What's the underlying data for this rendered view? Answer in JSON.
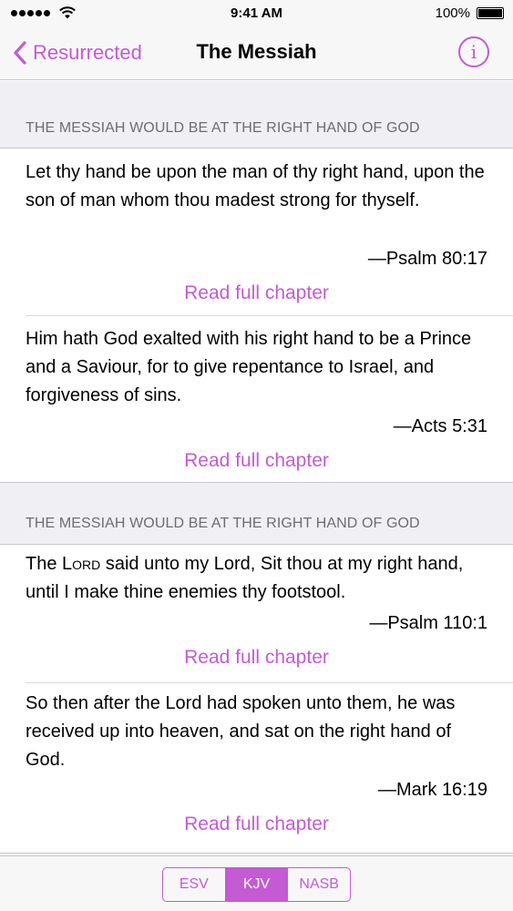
{
  "status_bar": {
    "time": "9:41 AM",
    "battery": "100%",
    "icons": [
      "signal-dots-icon",
      "wifi-icon",
      "battery-icon"
    ]
  },
  "nav": {
    "back_label": "Resurrected",
    "title": "The Messiah",
    "info_symbol": "i",
    "icons": [
      "chevron-left-icon",
      "info-icon"
    ]
  },
  "sections": [
    {
      "header": "THE MESSIAH WOULD BE AT THE RIGHT HAND OF GOD",
      "entries": [
        {
          "verse": "Let thy hand be upon the man of thy right hand, upon the son of man whom thou madest strong for thyself.",
          "reference": "—Psalm 80:17",
          "link": "Read full chapter"
        },
        {
          "verse": "Him hath God exalted with his right hand to be a Prince and a Saviour, for to give repentance to Israel, and forgiveness of sins.",
          "reference": "—Acts 5:31",
          "link": "Read full chapter"
        }
      ]
    },
    {
      "header": "THE MESSIAH WOULD BE AT THE RIGHT HAND OF GOD",
      "entries": [
        {
          "verse_parts": [
            "The ",
            "Lord",
            " said unto my Lord, Sit thou at my right hand, until I make thine enemies thy footstool."
          ],
          "reference": "—Psalm 110:1",
          "link": "Read full chapter"
        },
        {
          "verse": "So then after the Lord had spoken unto them, he was received up into heaven, and sat on the right hand of God.",
          "reference": "—Mark 16:19",
          "link": "Read full chapter"
        }
      ]
    }
  ],
  "translations": {
    "options": [
      "ESV",
      "KJV",
      "NASB"
    ],
    "selected": "KJV"
  },
  "colors": {
    "accent": "#c45ad4",
    "background": "#efeff4",
    "header_text": "#6d6d72"
  }
}
